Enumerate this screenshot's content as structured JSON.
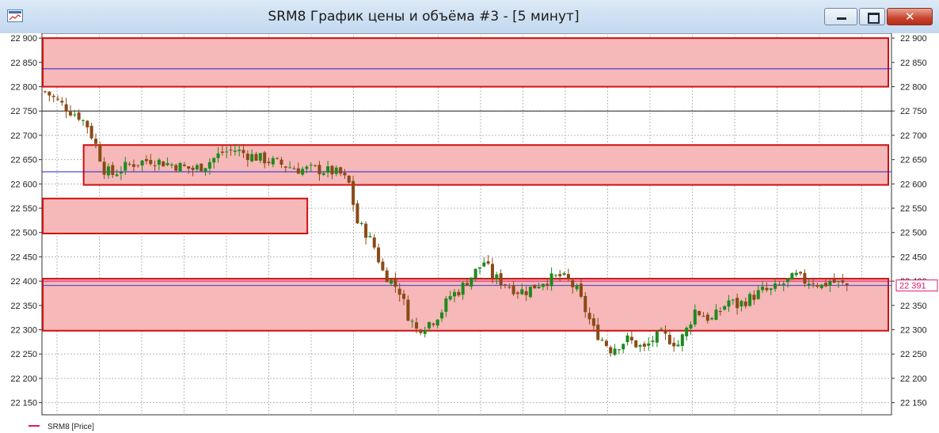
{
  "window": {
    "title": "SRM8 График цены и объёма #3 - [5 минут]",
    "close_glyph": "✕",
    "icons": {
      "app": "chart-app-icon",
      "minimize": "minimize-icon",
      "maximize": "maximize-icon",
      "close": "close-icon"
    }
  },
  "chart_data": {
    "type": "candlestick",
    "symbol": "SRM8",
    "interval": "5 минут",
    "ylim": [
      22125,
      22910
    ],
    "y_ticks": [
      22150,
      22200,
      22250,
      22300,
      22350,
      22400,
      22450,
      22500,
      22550,
      22600,
      22650,
      22700,
      22750,
      22800,
      22850,
      22900
    ],
    "y_tick_labels": [
      "22 150",
      "22 200",
      "22 250",
      "22 300",
      "22 350",
      "22 400",
      "22 450",
      "22 500",
      "22 550",
      "22 600",
      "22 650",
      "22 700",
      "22 750",
      "22 800",
      "22 850",
      "22 900"
    ],
    "grid": true,
    "legend_position": "bottom-left",
    "legend": [
      {
        "name": "SRM8 [Price]",
        "color": "#e0186c"
      }
    ],
    "last_price": 22391,
    "last_price_label": "22 391",
    "up_color": "#1e8a1e",
    "down_color": "#8a4a16",
    "zone_fill": "#f6b8b8",
    "zone_border": "#d01010",
    "zones": [
      {
        "bar_start": 0,
        "bar_end": 190,
        "low": 22800,
        "high": 22900
      },
      {
        "bar_start": 5,
        "bar_end": 190,
        "low": 22598,
        "high": 22680
      },
      {
        "bar_start": 0,
        "bar_end": 58,
        "low": 22498,
        "high": 22570
      },
      {
        "bar_start": 0,
        "bar_end": 190,
        "low": 22298,
        "high": 22405
      }
    ],
    "horizontal_lines": [
      {
        "value": 22837,
        "color": "#2020d0",
        "bar_start": 0
      },
      {
        "value": 22750,
        "color": "#222222",
        "bar_start": 0
      },
      {
        "value": 22625,
        "color": "#2020d0",
        "bar_start": 0
      },
      {
        "value": 22400,
        "color": "#d01070",
        "bar_start": 0
      },
      {
        "value": 22391,
        "color": "#4040d0",
        "bar_start": 0
      }
    ],
    "close_path": [
      [
        0,
        22790
      ],
      [
        3,
        22770
      ],
      [
        6,
        22750
      ],
      [
        8,
        22740
      ],
      [
        10,
        22720
      ],
      [
        12,
        22680
      ],
      [
        14,
        22630
      ],
      [
        16,
        22620
      ],
      [
        20,
        22640
      ],
      [
        25,
        22650
      ],
      [
        30,
        22640
      ],
      [
        35,
        22630
      ],
      [
        38,
        22640
      ],
      [
        42,
        22665
      ],
      [
        45,
        22670
      ],
      [
        48,
        22660
      ],
      [
        52,
        22650
      ],
      [
        56,
        22640
      ],
      [
        60,
        22630
      ],
      [
        64,
        22630
      ],
      [
        68,
        22625
      ],
      [
        70,
        22620
      ],
      [
        72,
        22600
      ],
      [
        74,
        22520
      ],
      [
        76,
        22500
      ],
      [
        78,
        22470
      ],
      [
        80,
        22420
      ],
      [
        82,
        22400
      ],
      [
        84,
        22380
      ],
      [
        86,
        22330
      ],
      [
        88,
        22300
      ],
      [
        90,
        22310
      ],
      [
        92,
        22320
      ],
      [
        94,
        22340
      ],
      [
        96,
        22370
      ],
      [
        98,
        22380
      ],
      [
        100,
        22400
      ],
      [
        102,
        22420
      ],
      [
        104,
        22440
      ],
      [
        106,
        22410
      ],
      [
        108,
        22400
      ],
      [
        110,
        22390
      ],
      [
        112,
        22380
      ],
      [
        114,
        22380
      ],
      [
        116,
        22390
      ],
      [
        118,
        22400
      ],
      [
        122,
        22410
      ],
      [
        124,
        22400
      ],
      [
        126,
        22380
      ],
      [
        128,
        22340
      ],
      [
        130,
        22300
      ],
      [
        132,
        22280
      ],
      [
        134,
        22260
      ],
      [
        136,
        22270
      ],
      [
        138,
        22280
      ],
      [
        140,
        22270
      ],
      [
        142,
        22260
      ],
      [
        144,
        22280
      ],
      [
        146,
        22290
      ],
      [
        148,
        22280
      ],
      [
        150,
        22270
      ],
      [
        152,
        22300
      ],
      [
        154,
        22340
      ],
      [
        156,
        22330
      ],
      [
        158,
        22320
      ],
      [
        160,
        22340
      ],
      [
        162,
        22360
      ],
      [
        164,
        22350
      ],
      [
        166,
        22360
      ],
      [
        168,
        22370
      ],
      [
        170,
        22380
      ],
      [
        172,
        22380
      ],
      [
        174,
        22390
      ],
      [
        176,
        22400
      ],
      [
        178,
        22410
      ],
      [
        180,
        22400
      ],
      [
        182,
        22400
      ],
      [
        184,
        22390
      ],
      [
        186,
        22400
      ],
      [
        188,
        22395
      ],
      [
        190,
        22391
      ]
    ]
  }
}
